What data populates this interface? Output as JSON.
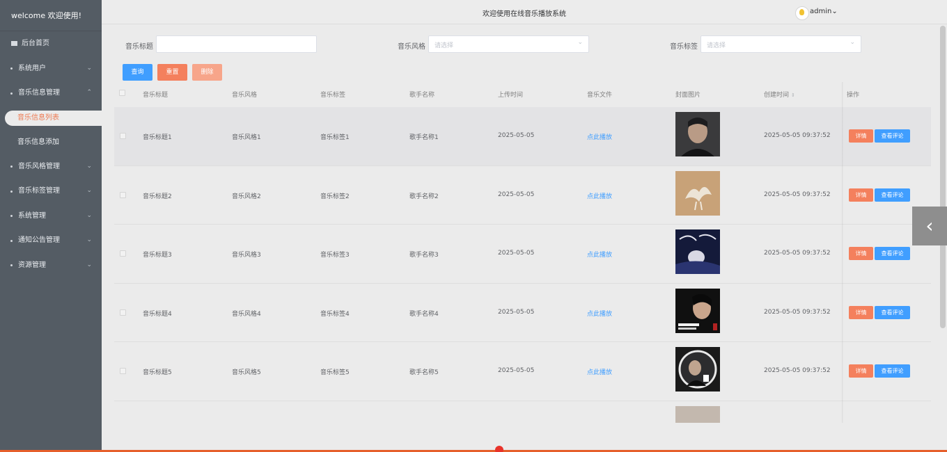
{
  "sidebar": {
    "welcome": "welcome 欢迎使用!",
    "items": [
      {
        "label": "后台首页"
      },
      {
        "label": "系统用户"
      },
      {
        "label": "音乐信息管理"
      },
      {
        "label": "音乐信息列表"
      },
      {
        "label": "音乐信息添加"
      },
      {
        "label": "音乐风格管理"
      },
      {
        "label": "音乐标签管理"
      },
      {
        "label": "系统管理"
      },
      {
        "label": "通知公告管理"
      },
      {
        "label": "资源管理"
      }
    ]
  },
  "header": {
    "title": "欢迎使用在线音乐播放系统",
    "user": "admin"
  },
  "search": {
    "title_label": "音乐标题",
    "title_value": "",
    "style_label": "音乐风格",
    "style_placeholder": "请选择",
    "tag_label": "音乐标签",
    "tag_placeholder": "请选择",
    "query": "查询",
    "reset": "重置",
    "delete": "删除"
  },
  "table": {
    "columns": [
      "音乐标题",
      "音乐风格",
      "音乐标签",
      "歌手名称",
      "上传时间",
      "音乐文件",
      "封面图片",
      "创建时间",
      "操作"
    ],
    "rows": [
      {
        "title": "音乐标题1",
        "style": "音乐风格1",
        "tag": "音乐标签1",
        "singer": "歌手名称1",
        "upload": "2025-05-05",
        "file": "点此播放",
        "created": "2025-05-05 09:37:52",
        "detail": "详情",
        "comment": "查看评论"
      },
      {
        "title": "音乐标题2",
        "style": "音乐风格2",
        "tag": "音乐标签2",
        "singer": "歌手名称2",
        "upload": "2025-05-05",
        "file": "点此播放",
        "created": "2025-05-05 09:37:52",
        "detail": "详情",
        "comment": "查看评论"
      },
      {
        "title": "音乐标题3",
        "style": "音乐风格3",
        "tag": "音乐标签3",
        "singer": "歌手名称3",
        "upload": "2025-05-05",
        "file": "点此播放",
        "created": "2025-05-05 09:37:52",
        "detail": "详情",
        "comment": "查看评论"
      },
      {
        "title": "音乐标题4",
        "style": "音乐风格4",
        "tag": "音乐标签4",
        "singer": "歌手名称4",
        "upload": "2025-05-05",
        "file": "点此播放",
        "created": "2025-05-05 09:37:52",
        "detail": "详情",
        "comment": "查看评论"
      },
      {
        "title": "音乐标题5",
        "style": "音乐风格5",
        "tag": "音乐标签5",
        "singer": "歌手名称5",
        "upload": "2025-05-05",
        "file": "点此播放",
        "created": "2025-05-05 09:37:52",
        "detail": "详情",
        "comment": "查看评论"
      }
    ]
  },
  "float": {
    "icon": "chevron-left-icon"
  }
}
